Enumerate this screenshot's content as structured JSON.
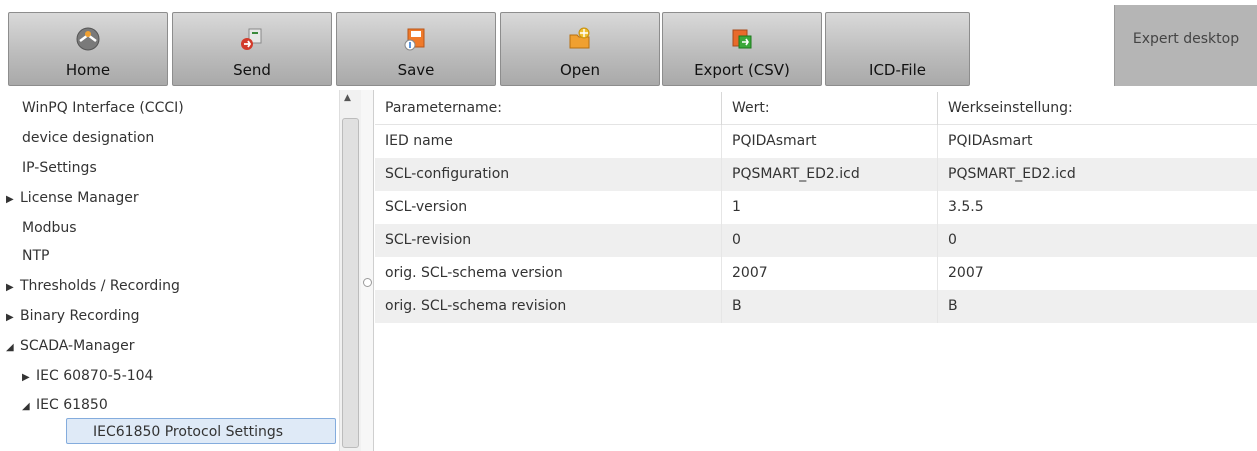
{
  "toolbar": {
    "buttons": [
      {
        "label": "Home",
        "icon": "home-icon"
      },
      {
        "label": "Send",
        "icon": "send-icon"
      },
      {
        "label": "Save",
        "icon": "save-icon"
      },
      {
        "label": "Open",
        "icon": "open-icon"
      },
      {
        "label": "Export (CSV)",
        "icon": "export-csv-icon"
      },
      {
        "label": "ICD-File",
        "icon": ""
      }
    ],
    "expert_label": "Expert desktop"
  },
  "tree": {
    "items": [
      {
        "label": "WinPQ Interface (CCCI)",
        "expander": ""
      },
      {
        "label": "device designation",
        "expander": ""
      },
      {
        "label": "IP-Settings",
        "expander": ""
      },
      {
        "label": "License Manager",
        "expander": "▶"
      },
      {
        "label": "Modbus",
        "expander": ""
      },
      {
        "label": "NTP",
        "expander": ""
      },
      {
        "label": "Thresholds / Recording",
        "expander": "▶"
      },
      {
        "label": "Binary Recording",
        "expander": "▶"
      },
      {
        "label": "SCADA-Manager",
        "expander": "◢"
      },
      {
        "label": "IEC 60870-5-104",
        "expander": "▶"
      },
      {
        "label": "IEC 61850",
        "expander": "◢"
      },
      {
        "label": "IEC61850 Protocol Settings",
        "expander": "",
        "selected": true
      }
    ]
  },
  "table": {
    "headers": [
      "Parametername:",
      "Wert:",
      "Werkseinstellung:"
    ],
    "rows": [
      [
        "IED name",
        "PQIDAsmart",
        "PQIDAsmart"
      ],
      [
        "SCL-configuration",
        "PQSMART_ED2.icd",
        "PQSMART_ED2.icd"
      ],
      [
        "SCL-version",
        "1",
        "3.5.5"
      ],
      [
        "SCL-revision",
        "0",
        "0"
      ],
      [
        "orig. SCL-schema version",
        "2007",
        "2007"
      ],
      [
        "orig. SCL-schema revision",
        "B",
        "B"
      ]
    ]
  },
  "colors": {
    "selection_bg": "#dfeaf7",
    "selection_border": "#84acdd",
    "row_alt": "#efefef"
  }
}
